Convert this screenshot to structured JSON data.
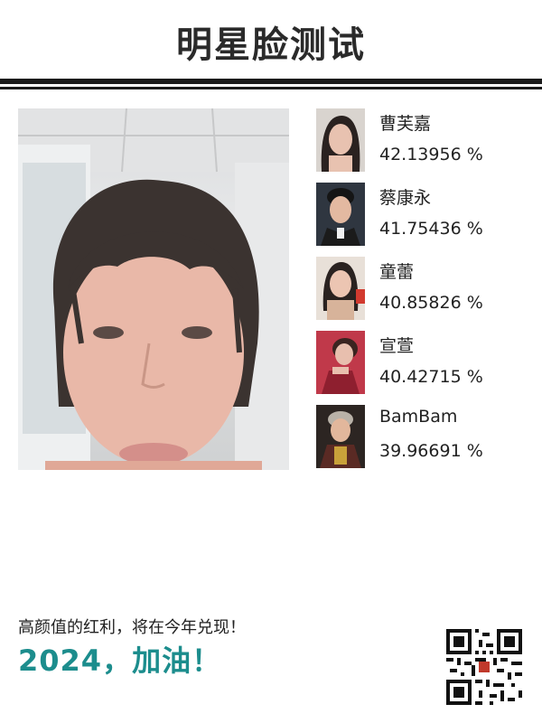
{
  "header": {
    "title": "明星脸测试"
  },
  "results": [
    {
      "name": "曹芙嘉",
      "score": "42.13956 %"
    },
    {
      "name": "蔡康永",
      "score": "41.75436 %"
    },
    {
      "name": "童蕾",
      "score": "40.85826 %"
    },
    {
      "name": "宣萱",
      "score": "40.42715 %"
    },
    {
      "name": "BamBam",
      "score": "39.96691 %"
    }
  ],
  "footer": {
    "slogan": "高颜值的红利，将在今年兑现！",
    "cheer": "2024，加油！"
  },
  "colors": {
    "title": "#2a2a2a",
    "rule": "#1b1b1b",
    "cheer": "#1c8d8d"
  },
  "icons": {
    "qr": "qr-code-icon"
  }
}
